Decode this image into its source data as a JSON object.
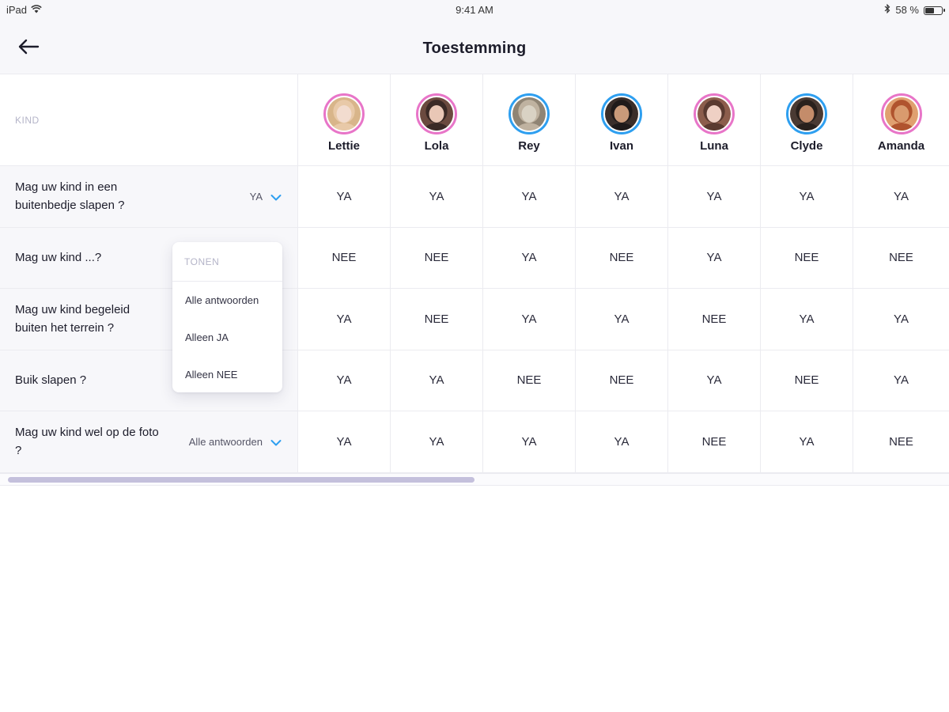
{
  "status_bar": {
    "device": "iPad",
    "time": "9:41 AM",
    "battery": "58 %",
    "battery_fraction": 0.58,
    "icons": [
      "wifi-icon",
      "bluetooth-icon",
      "battery-icon"
    ]
  },
  "nav": {
    "title": "Toestemming",
    "back_icon": "arrow-left-icon"
  },
  "table": {
    "header_label": "KIND",
    "children": [
      {
        "name": "Lettie",
        "ring": "pink"
      },
      {
        "name": "Lola",
        "ring": "pink"
      },
      {
        "name": "Rey",
        "ring": "blue"
      },
      {
        "name": "Ivan",
        "ring": "blue"
      },
      {
        "name": "Luna",
        "ring": "pink"
      },
      {
        "name": "Clyde",
        "ring": "blue"
      },
      {
        "name": "Amanda",
        "ring": "pink"
      }
    ],
    "questions": [
      {
        "text": "Mag uw kind in een buitenbedje slapen ?",
        "filter": "YA",
        "answers": [
          "YA",
          "YA",
          "YA",
          "YA",
          "YA",
          "YA",
          "YA"
        ]
      },
      {
        "text": "Mag uw kind ...?",
        "filter": "",
        "answers": [
          "NEE",
          "NEE",
          "YA",
          "NEE",
          "YA",
          "NEE",
          "NEE"
        ]
      },
      {
        "text": "Mag uw kind begeleid buiten het terrein ?",
        "filter": "",
        "answers": [
          "YA",
          "NEE",
          "YA",
          "YA",
          "NEE",
          "YA",
          "YA"
        ]
      },
      {
        "text": "Buik slapen ?",
        "filter": "",
        "answers": [
          "YA",
          "YA",
          "NEE",
          "NEE",
          "YA",
          "NEE",
          "YA"
        ]
      },
      {
        "text": "Mag uw kind wel op de foto ?",
        "filter": "Alle antwoorden",
        "answers": [
          "YA",
          "YA",
          "YA",
          "YA",
          "NEE",
          "YA",
          "NEE"
        ]
      }
    ]
  },
  "dropdown": {
    "header": "TONEN",
    "options": [
      "Alle antwoorden",
      "Alleen JA",
      "Alleen NEE"
    ]
  },
  "scrollbar": {
    "horizontal_position_fraction": 0.5
  },
  "colors": {
    "ring_pink": "#e875c8",
    "ring_blue": "#2e9ff0",
    "chevron_blue": "#2e9ff0",
    "scroll_thumb": "#c4c0dc",
    "muted_label": "#b4b4c8"
  }
}
